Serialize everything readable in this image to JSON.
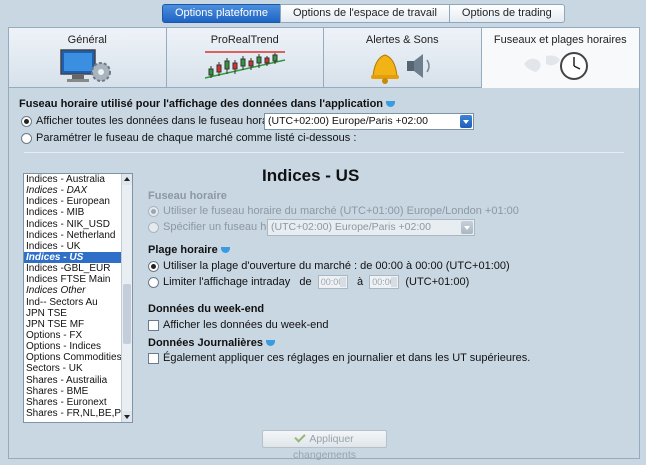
{
  "top_tabs": [
    "Options plateforme",
    "Options de l'espace de travail",
    "Options de trading"
  ],
  "category_tabs": [
    "Général",
    "ProRealTrend",
    "Alertes & Sons",
    "Fuseaux et plages horaires"
  ],
  "timezone_section": {
    "title": "Fuseau horaire utilisé pour l'affichage des données dans l'application",
    "option_all": "Afficher toutes les données dans le fuseau horaire suivant :",
    "selected_timezone": "(UTC+02:00) Europe/Paris +02:00",
    "option_each": "Paramétrer le fuseau de chaque marché comme listé ci-dessous :"
  },
  "market_list": {
    "items": [
      {
        "label": "Indices - Australia",
        "italic": false
      },
      {
        "label": "Indices - DAX",
        "italic": true
      },
      {
        "label": "Indices - European",
        "italic": false
      },
      {
        "label": "Indices - MIB",
        "italic": false
      },
      {
        "label": "Indices - NIK_USD",
        "italic": false
      },
      {
        "label": "Indices - Netherland",
        "italic": false
      },
      {
        "label": "Indices - UK",
        "italic": false
      },
      {
        "label": "Indices - US",
        "italic": true,
        "selected": true
      },
      {
        "label": "Indices -GBL_EUR",
        "italic": false
      },
      {
        "label": "Indices FTSE Main",
        "italic": false
      },
      {
        "label": "Indices Other",
        "italic": true
      },
      {
        "label": "Ind-- Sectors Au",
        "italic": false
      },
      {
        "label": "JPN TSE",
        "italic": false
      },
      {
        "label": "JPN TSE MF",
        "italic": false
      },
      {
        "label": "Options - FX",
        "italic": false
      },
      {
        "label": "Options - Indices",
        "italic": false
      },
      {
        "label": "Options Commodities",
        "italic": false
      },
      {
        "label": "Sectors - UK",
        "italic": false
      },
      {
        "label": "Shares - Austrailia",
        "italic": false
      },
      {
        "label": "Shares - BME",
        "italic": false
      },
      {
        "label": "Shares - Euronext",
        "italic": false
      },
      {
        "label": "Shares - FR,NL,BE,P",
        "italic": false
      }
    ]
  },
  "detail": {
    "title": "Indices - US",
    "fuseau_title": "Fuseau horaire",
    "fuseau_market": "Utiliser le fuseau horaire du marché (UTC+01:00) Europe/London +01:00",
    "fuseau_specify": "Spécifier un fuseau horaire :",
    "fuseau_specify_value": "(UTC+02:00) Europe/Paris +02:00",
    "plage_title": "Plage horaire",
    "plage_open": "Utiliser la plage d'ouverture du marché : de 00:00 à 00:00  (UTC+01:00)",
    "plage_limit": "Limiter l'affichage intraday",
    "plage_de": "de",
    "plage_a": "à",
    "plage_from": "00:00",
    "plage_to": "00:00",
    "plage_tz": "(UTC+01:00)",
    "weekend_title": "Données du week-end",
    "weekend_option": "Afficher les données du week-end",
    "daily_title": "Données Journalières",
    "daily_option": "Également appliquer ces réglages en journalier et dans les UT supérieures."
  },
  "apply_button": "Appliquer changements",
  "colors": {
    "accent": "#1d63c4",
    "background": "#c9d7e3",
    "selection": "#2f6fc8"
  }
}
